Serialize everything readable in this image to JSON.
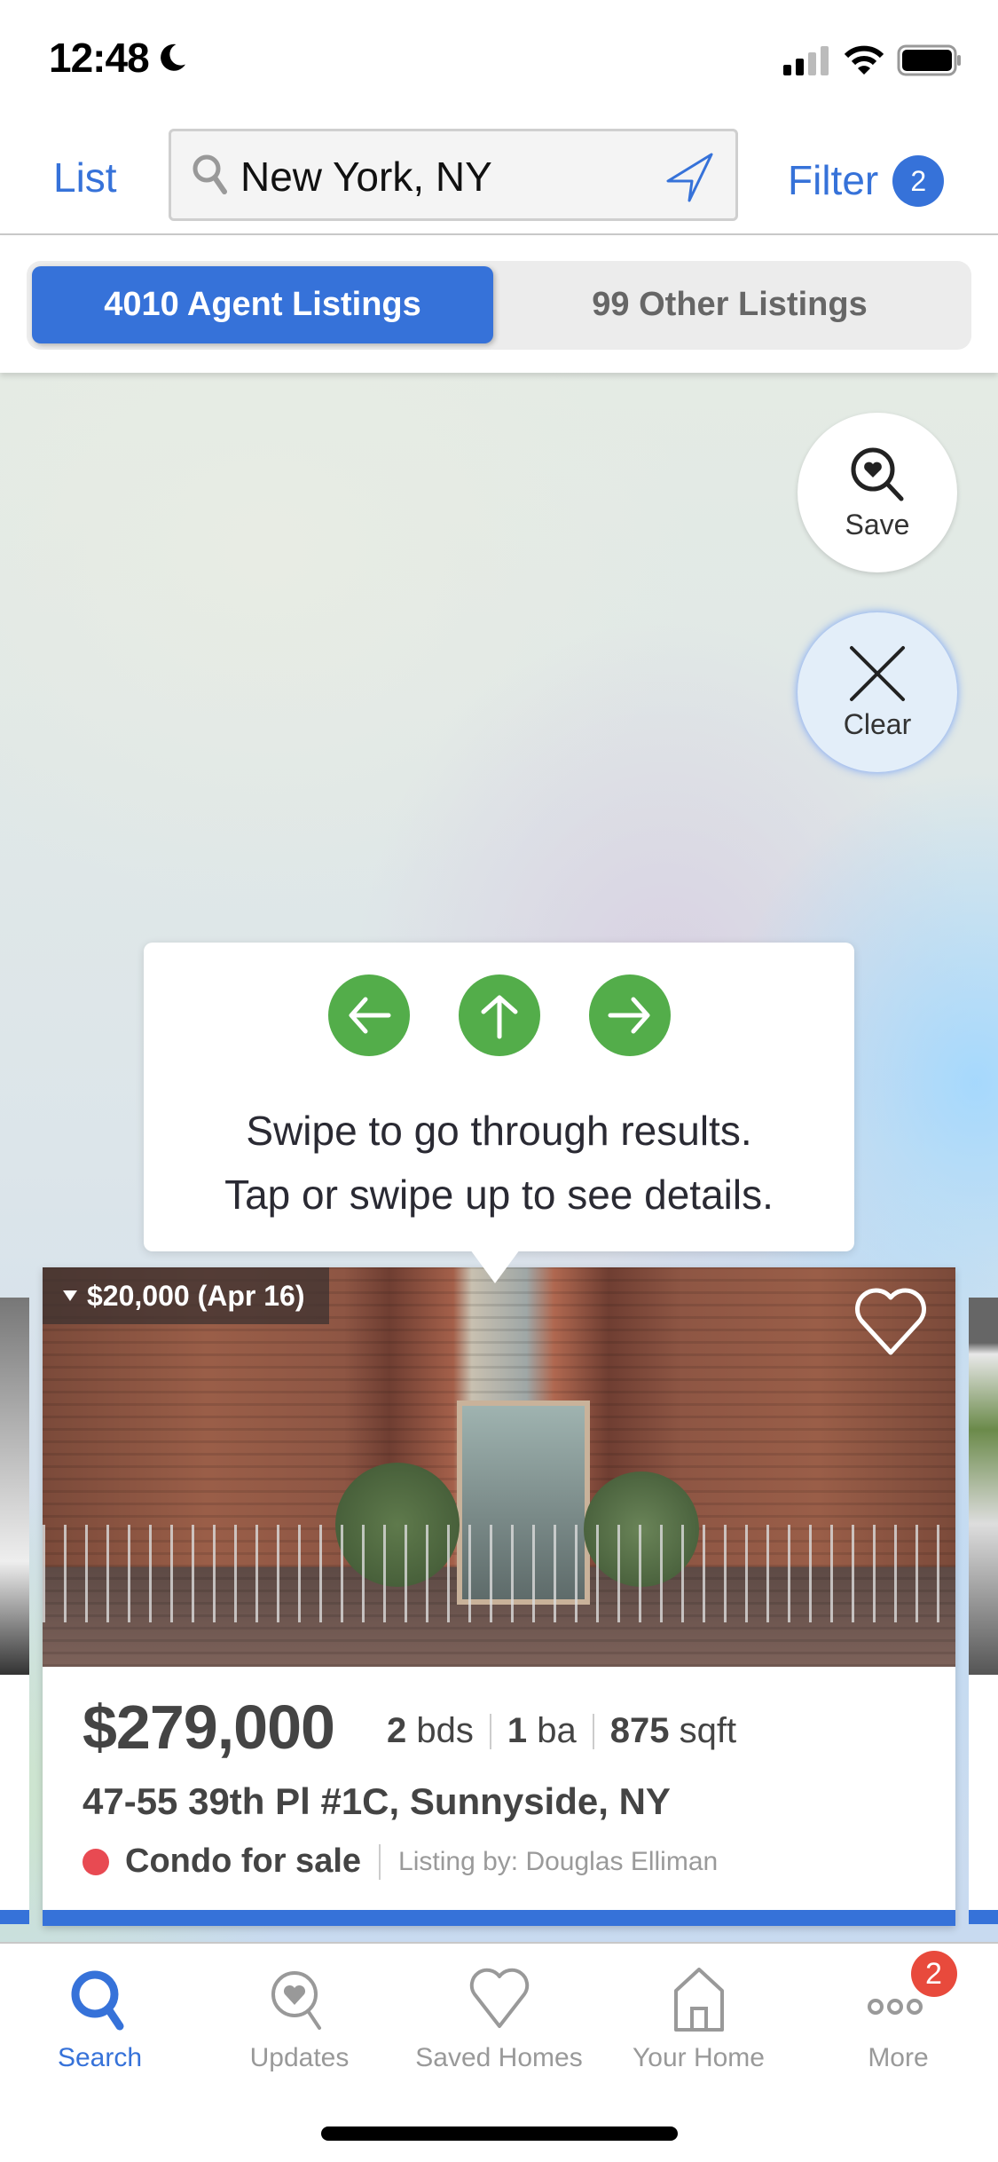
{
  "status_bar": {
    "time": "12:48",
    "icons": [
      "moon-icon",
      "cellular-signal-icon",
      "wifi-icon",
      "battery-icon"
    ]
  },
  "header": {
    "list_label": "List",
    "search": {
      "value": "New York, NY",
      "icon": "search-icon",
      "location_icon": "location-arrow-icon"
    },
    "filter_label": "Filter",
    "filter_count": "2"
  },
  "tabs": {
    "active": "4010 Agent Listings",
    "inactive": "99 Other Listings"
  },
  "map": {
    "save_label": "Save",
    "clear_label": "Clear"
  },
  "tooltip": {
    "line1": "Swipe to go through results.",
    "line2": "Tap or swipe up to see details.",
    "arrows": [
      "arrow-left-icon",
      "arrow-up-icon",
      "arrow-right-icon"
    ]
  },
  "listing": {
    "price_change": "$20,000 (Apr 16)",
    "price": "$279,000",
    "beds": "2",
    "beds_label": "bds",
    "baths": "1",
    "baths_label": "ba",
    "sqft": "875",
    "sqft_label": "sqft",
    "address": "47-55 39th Pl #1C, Sunnyside, NY",
    "status": "Condo for sale",
    "status_color": "#e84a52",
    "listing_by": "Listing by: Douglas Elliman"
  },
  "tabbar": {
    "items": [
      {
        "label": "Search",
        "icon": "search-icon",
        "active": true
      },
      {
        "label": "Updates",
        "icon": "heart-search-icon",
        "active": false
      },
      {
        "label": "Saved Homes",
        "icon": "heart-icon",
        "active": false
      },
      {
        "label": "Your Home",
        "icon": "house-icon",
        "active": false
      },
      {
        "label": "More",
        "icon": "more-dots-icon",
        "active": false,
        "badge": "2"
      }
    ]
  },
  "colors": {
    "accent": "#3672d9",
    "arrow_green": "#53ad4a",
    "badge_red": "#e84a3c"
  }
}
